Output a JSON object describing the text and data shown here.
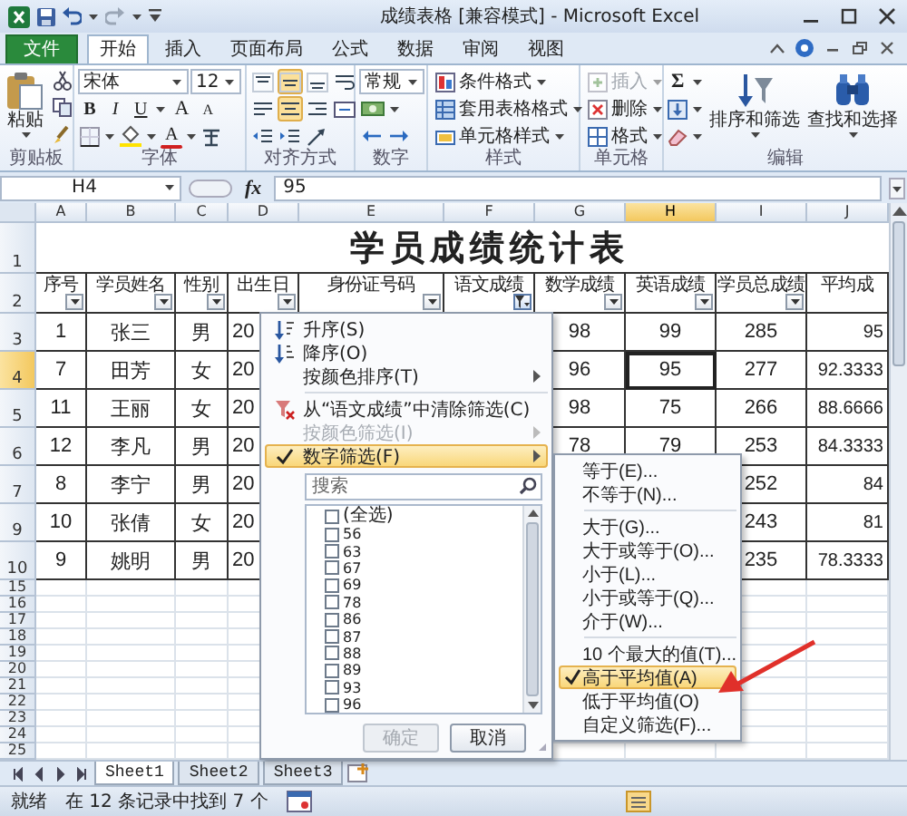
{
  "window": {
    "title": "成绩表格 [兼容模式] - Microsoft Excel"
  },
  "ribbon_tabs": [
    {
      "label": "文件",
      "kind": "file",
      "selected": false
    },
    {
      "label": "开始",
      "kind": "tab",
      "selected": true
    },
    {
      "label": "插入",
      "kind": "tab",
      "selected": false
    },
    {
      "label": "页面布局",
      "kind": "tab",
      "selected": false
    },
    {
      "label": "公式",
      "kind": "tab",
      "selected": false
    },
    {
      "label": "数据",
      "kind": "tab",
      "selected": false
    },
    {
      "label": "审阅",
      "kind": "tab",
      "selected": false
    },
    {
      "label": "视图",
      "kind": "tab",
      "selected": false
    }
  ],
  "clipboard": {
    "paste": "粘贴",
    "label": "剪贴板"
  },
  "font": {
    "name": "宋体",
    "size": "12",
    "styles": [
      "B",
      "I",
      "U"
    ],
    "grow": "A",
    "shrink": "A",
    "color_button": "A",
    "label": "字体"
  },
  "alignment": {
    "buttons": [
      {
        "selected": false
      },
      {
        "selected": true
      },
      {
        "selected": false
      },
      {
        "selected": false
      },
      {
        "selected": true
      },
      {
        "selected": false
      }
    ],
    "label": "对齐方式"
  },
  "number": {
    "format": "常规",
    "label": "数字"
  },
  "styles": {
    "items": [
      "条件格式",
      "套用表格格式",
      "单元格样式"
    ],
    "label": "样式"
  },
  "cells": {
    "items": [
      {
        "label": "插入",
        "disabled": true
      },
      {
        "label": "删除",
        "disabled": false
      },
      {
        "label": "格式",
        "disabled": false
      }
    ],
    "label": "单元格"
  },
  "editing": {
    "sum": "Σ",
    "sort": "排序和筛选",
    "find": "查找和选择",
    "label": "编辑"
  },
  "formula_bar": {
    "name_box": "H4",
    "fx": "fx",
    "value": "95"
  },
  "columns": [
    {
      "label": "A",
      "selected": false
    },
    {
      "label": "B",
      "selected": false
    },
    {
      "label": "C",
      "selected": false
    },
    {
      "label": "D",
      "selected": false
    },
    {
      "label": "E",
      "selected": false
    },
    {
      "label": "F",
      "selected": false
    },
    {
      "label": "G",
      "selected": false
    },
    {
      "label": "H",
      "selected": true
    },
    {
      "label": "I",
      "selected": false
    },
    {
      "label": "J",
      "selected": false
    }
  ],
  "sheet": {
    "title_row": {
      "number": "1",
      "title": "学员成绩统计表"
    },
    "header_row": {
      "number": "2",
      "headers": [
        {
          "label": "序号",
          "filter_button": true
        },
        {
          "label": "学员姓名",
          "filter_button": true
        },
        {
          "label": "性别",
          "filter_button": true
        },
        {
          "label": "出生日",
          "filter_button": true
        },
        {
          "label": "身份证号码",
          "filter_button": true
        },
        {
          "label": "语文成绩",
          "filter_button": true,
          "filtered": true
        },
        {
          "label": "数学成绩",
          "filter_button": true
        },
        {
          "label": "英语成绩",
          "filter_button": true
        },
        {
          "label": "学员总成绩",
          "filter_button": true
        },
        {
          "label": "平均成",
          "filter_button": false
        }
      ]
    },
    "rows": [
      {
        "number": "3",
        "selected": false,
        "cells": [
          "1",
          "张三",
          "男",
          "20",
          null,
          null,
          "98",
          "99",
          "285",
          "95"
        ]
      },
      {
        "number": "4",
        "selected": true,
        "cells": [
          "7",
          "田芳",
          "女",
          "20",
          null,
          null,
          "96",
          "95",
          "277",
          "92.3333"
        ]
      },
      {
        "number": "5",
        "selected": false,
        "cells": [
          "11",
          "王丽",
          "女",
          "20",
          null,
          null,
          "98",
          "75",
          "266",
          "88.6666"
        ]
      },
      {
        "number": "6",
        "selected": false,
        "cells": [
          "12",
          "李凡",
          "男",
          "20",
          null,
          null,
          "78",
          "79",
          "253",
          "84.3333"
        ]
      },
      {
        "number": "7",
        "selected": false,
        "cells": [
          "8",
          "李宁",
          "男",
          "20",
          null,
          null,
          null,
          null,
          "252",
          "84"
        ]
      },
      {
        "number": "9",
        "selected": false,
        "cells": [
          "10",
          "张倩",
          "女",
          "20",
          null,
          null,
          null,
          null,
          "243",
          "81"
        ]
      },
      {
        "number": "10",
        "selected": false,
        "cells": [
          "9",
          "姚明",
          "男",
          "20",
          null,
          null,
          null,
          null,
          "235",
          "78.3333"
        ]
      }
    ],
    "empty_rows": [
      "15",
      "16",
      "17",
      "18",
      "19",
      "20",
      "21",
      "22",
      "23",
      "24",
      "25"
    ]
  },
  "filter_menu": {
    "items": [
      {
        "label": "升序(S)",
        "kind": "sort-asc",
        "disabled": false,
        "submenu": false,
        "selected": false
      },
      {
        "label": "降序(O)",
        "kind": "sort-desc",
        "disabled": false,
        "submenu": false,
        "selected": false
      },
      {
        "label": "按颜色排序(T)",
        "kind": "plain",
        "disabled": false,
        "submenu": true,
        "selected": false
      },
      {
        "kind": "separator"
      },
      {
        "label": "从“语文成绩”中清除筛选(C)",
        "kind": "clear-filter",
        "disabled": false,
        "submenu": false,
        "selected": false
      },
      {
        "label": "按颜色筛选(I)",
        "kind": "plain",
        "disabled": true,
        "submenu": true,
        "selected": false
      },
      {
        "label": "数字筛选(F)",
        "kind": "checked",
        "disabled": false,
        "submenu": true,
        "selected": true
      }
    ],
    "search": {
      "placeholder": "搜索"
    },
    "values": [
      {
        "label": "(全选)",
        "checked": false
      },
      {
        "label": "56",
        "checked": false
      },
      {
        "label": "63",
        "checked": false
      },
      {
        "label": "67",
        "checked": false
      },
      {
        "label": "69",
        "checked": false
      },
      {
        "label": "78",
        "checked": false
      },
      {
        "label": "86",
        "checked": false
      },
      {
        "label": "87",
        "checked": false
      },
      {
        "label": "88",
        "checked": false
      },
      {
        "label": "89",
        "checked": false
      },
      {
        "label": "93",
        "checked": false
      },
      {
        "label": "96",
        "checked": false
      }
    ],
    "ok_button": {
      "label": "确定",
      "disabled": true
    },
    "cancel_button": {
      "label": "取消",
      "disabled": false
    }
  },
  "number_filter_menu": {
    "items": [
      {
        "label": "等于(E)...",
        "kind": "item",
        "checked": false,
        "selected": false
      },
      {
        "label": "不等于(N)...",
        "kind": "item",
        "checked": false,
        "selected": false
      },
      {
        "kind": "separator"
      },
      {
        "label": "大于(G)...",
        "kind": "item",
        "checked": false,
        "selected": false
      },
      {
        "label": "大于或等于(O)...",
        "kind": "item",
        "checked": false,
        "selected": false
      },
      {
        "label": "小于(L)...",
        "kind": "item",
        "checked": false,
        "selected": false
      },
      {
        "label": "小于或等于(Q)...",
        "kind": "item",
        "checked": false,
        "selected": false
      },
      {
        "label": "介于(W)...",
        "kind": "item",
        "checked": false,
        "selected": false
      },
      {
        "kind": "separator"
      },
      {
        "label": "10 个最大的值(T)...",
        "kind": "item",
        "checked": false,
        "selected": false
      },
      {
        "label": "高于平均值(A)",
        "kind": "item",
        "checked": true,
        "selected": true
      },
      {
        "label": "低于平均值(O)",
        "kind": "item",
        "checked": false,
        "selected": false
      },
      {
        "label": "自定义筛选(F)...",
        "kind": "item",
        "checked": false,
        "selected": false
      }
    ]
  },
  "sheet_tabs": [
    {
      "label": "Sheet1",
      "selected": true
    },
    {
      "label": "Sheet2",
      "selected": false
    },
    {
      "label": "Sheet3",
      "selected": false
    }
  ],
  "status_bar": {
    "mode": "就绪",
    "message": "在 12 条记录中找到 7 个"
  }
}
